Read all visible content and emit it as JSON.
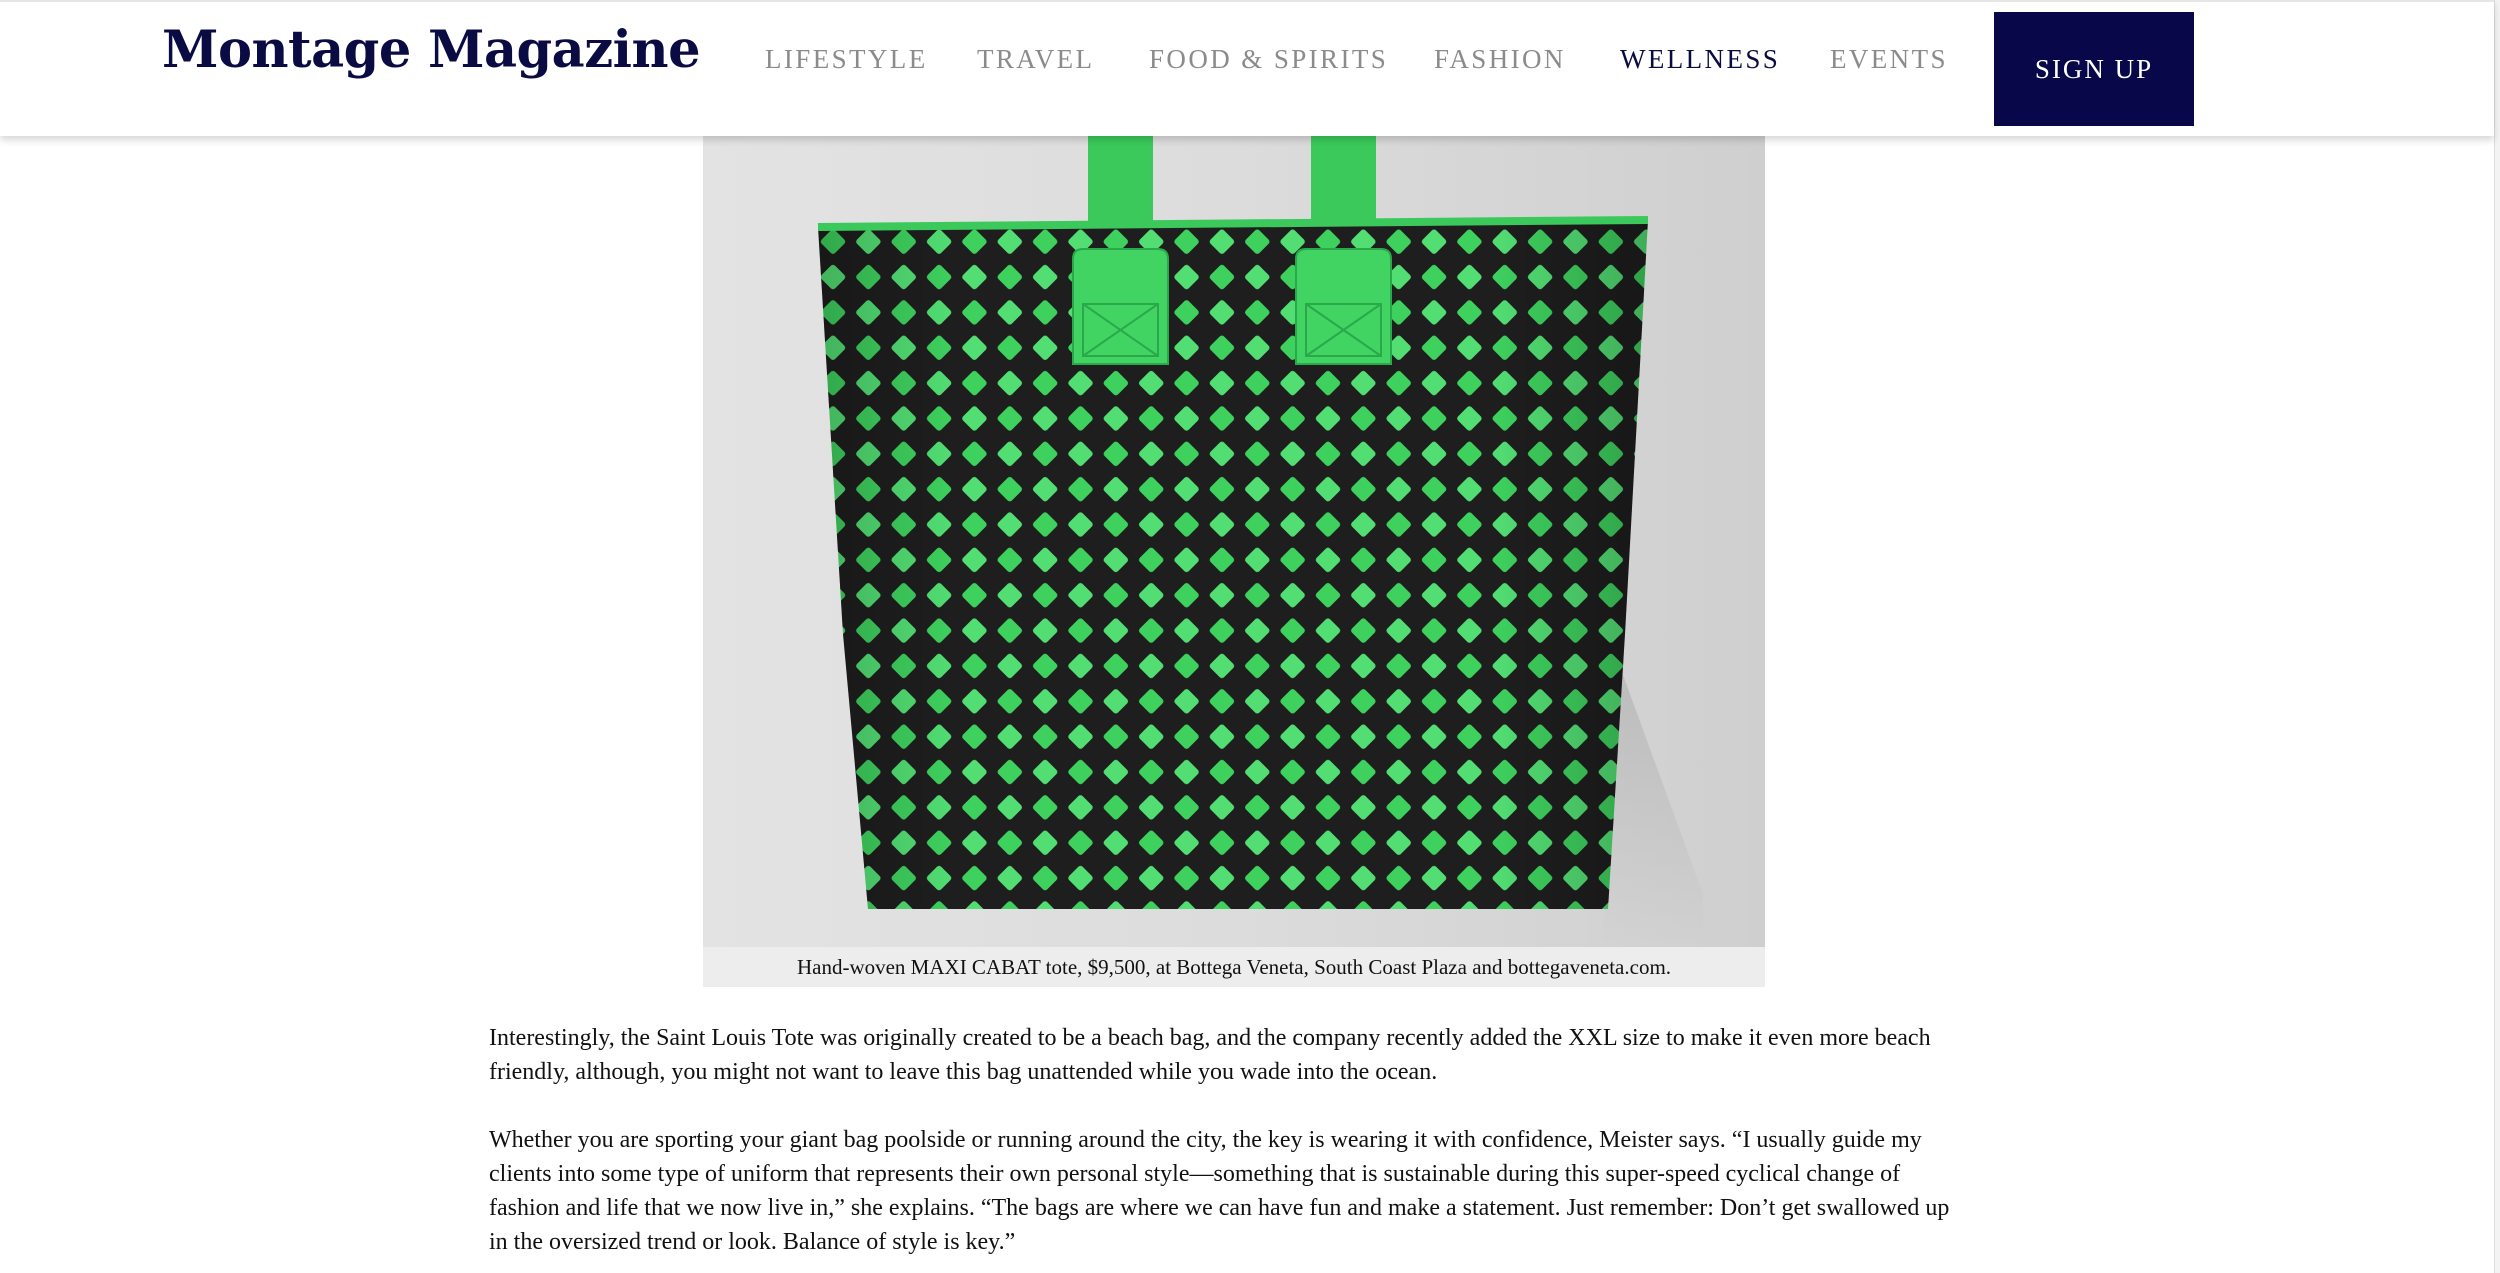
{
  "header": {
    "logo": "Montage Magazine",
    "nav": [
      {
        "label": "LIFESTYLE",
        "active": false
      },
      {
        "label": "TRAVEL",
        "active": false
      },
      {
        "label": "FOOD & SPIRITS",
        "active": false
      },
      {
        "label": "FASHION",
        "active": false
      },
      {
        "label": "WELLNESS",
        "active": true
      },
      {
        "label": "EVENTS",
        "active": false
      }
    ],
    "signup_label": "SIGN UP"
  },
  "figure": {
    "caption": "Hand-woven MAXI CABAT tote, $9,500, at Bottega Veneta, South Coast Plaza and bottegaveneta.com.",
    "colors": {
      "weave_green": "#3ed15e",
      "weave_dark": "#1e1e1e",
      "backdrop": "#dcdcdc"
    }
  },
  "article": {
    "paragraphs": [
      "Interestingly, the Saint Louis Tote was originally created to be a beach bag, and the company recently added the XXL size to make it even more beach friendly, although, you might not want to leave      this bag unattended while you wade into the ocean.",
      "Whether you are sporting your giant bag poolside or running around the city, the key is wearing it with confidence, Meister says. “I usually guide my clients into some type of uniform that represents their own personal style—something that is sustainable during this super-speed cyclical change of fashion and life that we now live in,” she explains. “The bags are where we can have fun and make a statement. Just remember: Don’t get swallowed up in the oversized trend or look. Balance of style is key.”"
    ]
  },
  "colors": {
    "brand_navy": "#0b0b44",
    "button_bg": "#07074a",
    "nav_inactive": "#8b8b8b"
  }
}
